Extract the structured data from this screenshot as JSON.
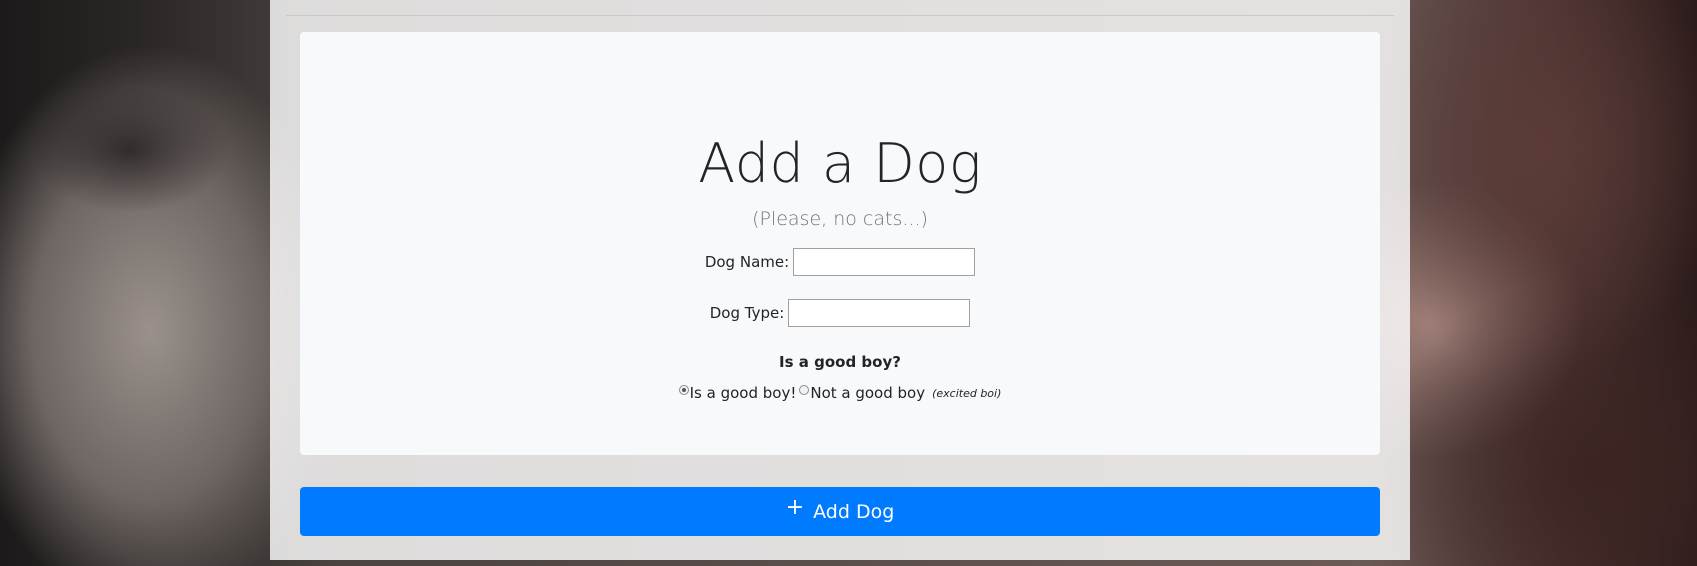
{
  "form": {
    "title": "Add a Dog",
    "subtitle": "(Please, no cats...)",
    "name_label": "Dog Name:",
    "name_value": "",
    "type_label": "Dog Type:",
    "type_value": "",
    "good_boy_question": "Is a good boy?",
    "options": [
      {
        "label": "Is a good boy!",
        "selected": true
      },
      {
        "label": "Not a good boy",
        "selected": false,
        "note": "(excited boi)"
      }
    ]
  },
  "submit": {
    "icon": "plus-icon",
    "label": "Add Dog"
  },
  "colors": {
    "primary": "#007bff",
    "card": "#f8f9fa"
  }
}
